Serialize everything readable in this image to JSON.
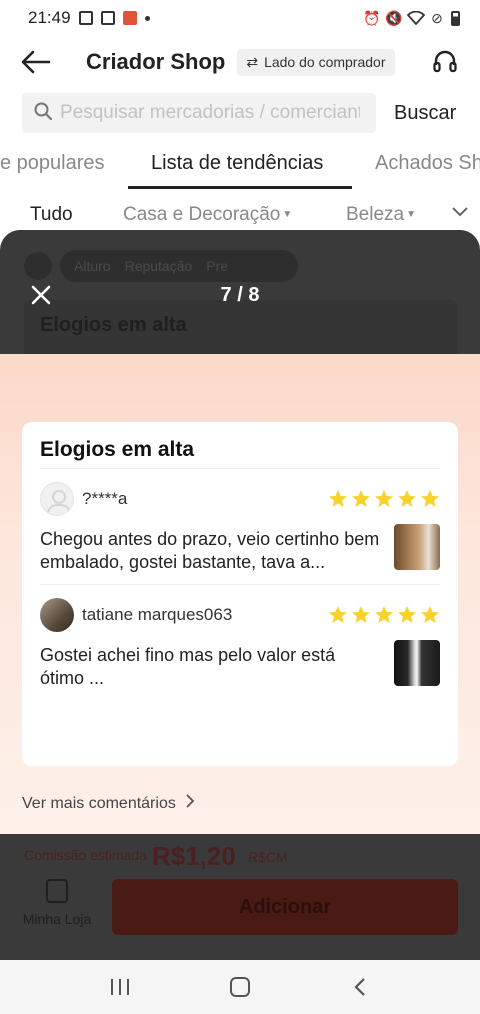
{
  "status_bar": {
    "time": "21:49"
  },
  "header": {
    "title": "Criador Shop",
    "buyer_pill": "Lado do comprador"
  },
  "search": {
    "placeholder": "Pesquisar mercadorias / comerciantes",
    "button": "Buscar"
  },
  "tabs": [
    "e populares",
    "Lista de tendências",
    "Achados Sh"
  ],
  "categories": [
    "Tudo",
    "Casa e Decoração",
    "Beleza"
  ],
  "background": {
    "pill_items": [
      "Alturo",
      "Reputação",
      "Pre"
    ],
    "section_title": "Elogios em alta",
    "commission_label": "Comissão estimada",
    "commission_value": "R$1,20",
    "commission_unit": "R$CM",
    "store_label": "Minha Loja",
    "add_button": "Adicionar"
  },
  "modal": {
    "counter": "7 / 8",
    "card_title": "Elogios em alta",
    "reviews": [
      {
        "name": "?****a",
        "stars": 5,
        "text": "Chegou antes do prazo, veio certinho bem embalado, gostei bastante, tava a..."
      },
      {
        "name": "tatiane marques063",
        "stars": 5,
        "text": "Gostei achei fino mas pelo valor está ótimo ..."
      }
    ],
    "more_link": "Ver mais comentários"
  },
  "colors": {
    "star": "#f7d22a",
    "overlay": "#3a3a3a",
    "panel_top": "#fcd9c9"
  }
}
